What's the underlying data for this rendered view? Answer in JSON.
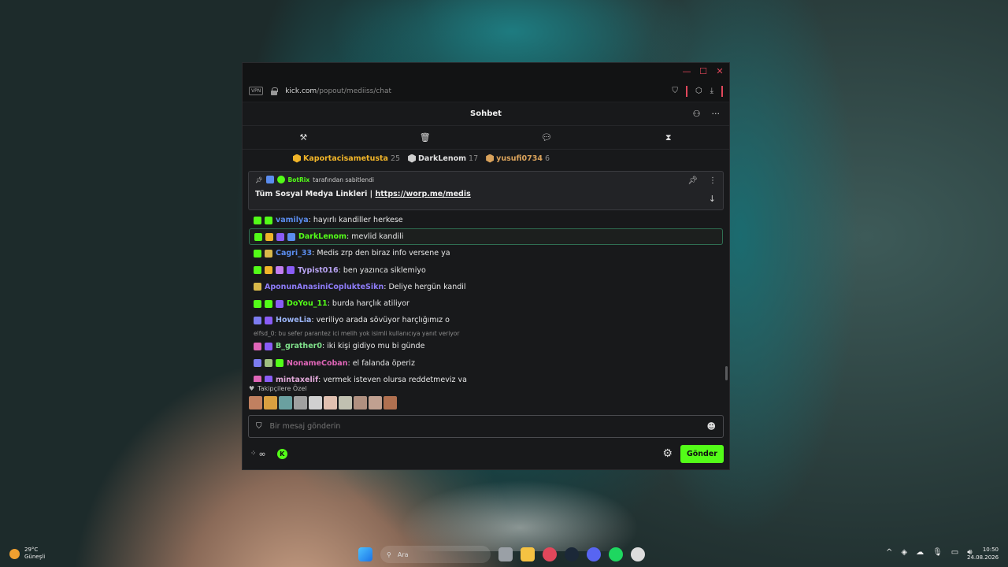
{
  "browser": {
    "vpn_label": "VPN",
    "url_host": "kick.com",
    "url_path": "/popout/mediiss/chat",
    "window_controls": [
      "minimize-icon",
      "maximize-icon",
      "close-icon"
    ]
  },
  "chat": {
    "title": "Sohbet",
    "mod_tools": [
      "gavel-icon",
      "trash-icon",
      "chat-bubble-icon",
      "hourglass-icon"
    ],
    "top_gifters": [
      {
        "name": "Kaportacisametusta",
        "count": "25",
        "color": "#f0b429"
      },
      {
        "name": "DarkLenom",
        "count": "17",
        "color": "#e0e0e0"
      },
      {
        "name": "yusufi0734",
        "count": "6",
        "color": "#d9a25b"
      }
    ],
    "pinned": {
      "by_user": "BotRix",
      "by_text": "tarafından sabitlendi",
      "message": "Tüm Sosyal Medya Linkleri |",
      "link": "https://worp.me/medis"
    },
    "messages": [
      {
        "user": "vamilya",
        "text": ": hayırlı kandiller herkese",
        "color": "#5b8def",
        "badges": [
          "#53fc18",
          "#53fc18"
        ]
      },
      {
        "user": "DarkLenom",
        "text": ": mevlid kandili",
        "color": "#53fc18",
        "badges": [
          "#53fc18",
          "#f0b429",
          "#8a5cf6",
          "#5b8def"
        ],
        "highlight": true
      },
      {
        "user": "Cagri_33",
        "text": ": Medis zrp den biraz info versene ya",
        "color": "#5b8def",
        "badges": [
          "#53fc18",
          "#d9b94a"
        ]
      },
      {
        "user": "Typist016",
        "text": ": ben yazınca siklemiyo",
        "color": "#b7a2f0",
        "badges": [
          "#53fc18",
          "#f0b429",
          "#c27ef0",
          "#8a5cf6"
        ]
      },
      {
        "user": "AponunAnasiniCoplukteSikn",
        "text": ": Deliye hergün kandil",
        "color": "#8e7cf8",
        "badges": [
          "#d9b94a"
        ]
      },
      {
        "user": "DoYou_11",
        "text": ": burda harçlık atiliyor",
        "color": "#53fc18",
        "badges": [
          "#53fc18",
          "#53fc18",
          "#8a5cf6"
        ]
      },
      {
        "user": "HoweLia",
        "text": ": veriliyo arada sövüyor harçlığımız o",
        "color": "#9ab3f5",
        "badges": [
          "#7c7cf0",
          "#8a5cf6"
        ]
      },
      {
        "user": "B_grather0",
        "text": ": iki kişi gidiyo mu bi günde",
        "color": "#7fe08a",
        "badges": [
          "#e066b8",
          "#8a5cf6"
        ],
        "reply": "elfsd_0: bu sefer parantez ici melih yok isimli kullanıcıya yanıt veriyor"
      },
      {
        "user": "NonameCoban",
        "text": ": el falanda öperiz",
        "color": "#e066b8",
        "badges": [
          "#7c7cf0",
          "#a0c080",
          "#53fc18"
        ]
      },
      {
        "user": "mintaxelif",
        "text": ": vermek isteyen olursa reddetmeyiz ya",
        "color": "#e0a8d8",
        "badges": [
          "#e066b8",
          "#8a5cf6"
        ]
      }
    ],
    "emotes_label": "Takipçilere Özel",
    "emotes": [
      "#c08060",
      "#d9a040",
      "#6aa0a0",
      "#a0a0a0",
      "#d0d0d0",
      "#e0c0b0",
      "#c0c0b0",
      "#b09080",
      "#c0a090",
      "#b07050"
    ],
    "input_placeholder": "Bir mesaj gönderin",
    "points_label": "∞",
    "send_label": "Gönder",
    "accent": "#53fc18"
  },
  "taskbar": {
    "weather_temp": "29°C",
    "weather_desc": "Güneşli",
    "search_placeholder": "Ara",
    "time": "10:50",
    "date": "24.08.2026"
  }
}
